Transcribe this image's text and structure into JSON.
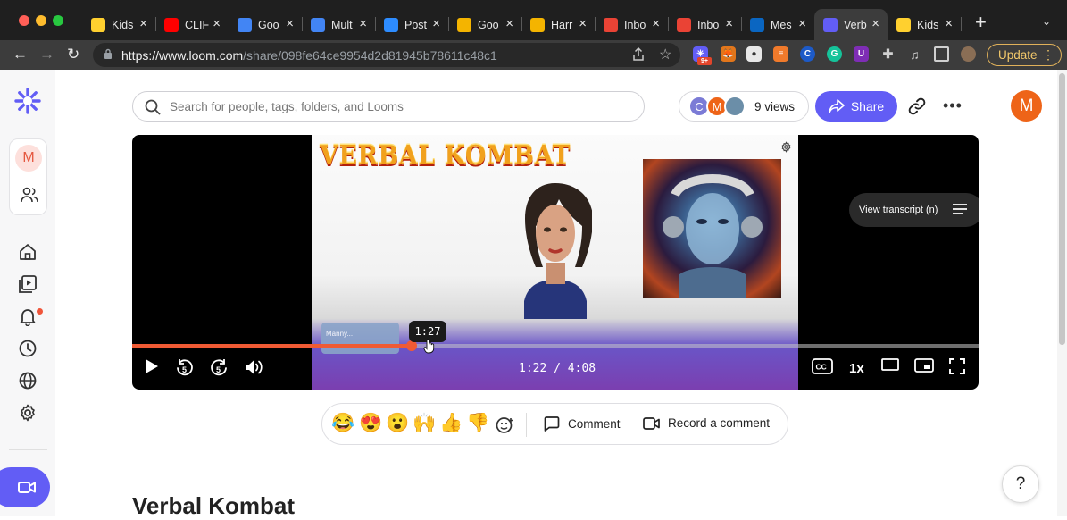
{
  "browser": {
    "tabs": [
      {
        "label": "Kids",
        "icon": "miro-icon",
        "color": "#ffd02f"
      },
      {
        "label": "CLIF",
        "icon": "youtube-icon",
        "color": "#ff0000"
      },
      {
        "label": "Goo",
        "icon": "google-calendar-icon",
        "color": "#4285f4"
      },
      {
        "label": "Mult",
        "icon": "google-calendar-icon",
        "color": "#4285f4"
      },
      {
        "label": "Post",
        "icon": "zoom-icon",
        "color": "#2d8cff"
      },
      {
        "label": "Goo",
        "icon": "google-slides-icon",
        "color": "#f4b400"
      },
      {
        "label": "Harr",
        "icon": "google-slides-icon",
        "color": "#f4b400"
      },
      {
        "label": "Inbo",
        "icon": "gmail-icon",
        "color": "#ea4335"
      },
      {
        "label": "Inbo",
        "icon": "gmail-icon",
        "color": "#ea4335"
      },
      {
        "label": "Mes",
        "icon": "linkedin-icon",
        "color": "#0a66c2"
      },
      {
        "label": "Verb",
        "icon": "loom-icon",
        "color": "#625df5",
        "active": true
      },
      {
        "label": "Kids",
        "icon": "miro-icon",
        "color": "#ffd02f"
      }
    ],
    "url_domain": "https://www.loom.com",
    "url_path": "/share/098fe64ce9954d2d81945b78611c48c1",
    "update_label": "Update"
  },
  "header": {
    "search_placeholder": "Search for people, tags, folders, and Looms",
    "views_label": "9 views",
    "viewer_avatars": [
      {
        "initial": "C",
        "color": "#7b7bd6"
      },
      {
        "initial": "M",
        "color": "#ee6418"
      },
      {
        "initial": "",
        "color": "#6b8ea8"
      }
    ],
    "share_label": "Share",
    "user_initial": "M"
  },
  "sidebar": {
    "workspace_initial": "M"
  },
  "player": {
    "video_title_art": "VERBAL KOMBAT",
    "transcript_label": "View transcript (n)",
    "hover_time": "1:27",
    "current_time": "1:22",
    "duration": "4:08",
    "time_display": "1:22 / 4:08",
    "progress": 0.33,
    "speed": "1x",
    "blurred_card_text": "Manny..."
  },
  "reactions": {
    "emojis": [
      "😂",
      "😍",
      "😮",
      "🙌",
      "👍",
      "👎"
    ],
    "comment_label": "Comment",
    "record_comment_label": "Record a comment"
  },
  "video": {
    "title": "Verbal Kombat"
  },
  "help": {
    "label": "?"
  }
}
